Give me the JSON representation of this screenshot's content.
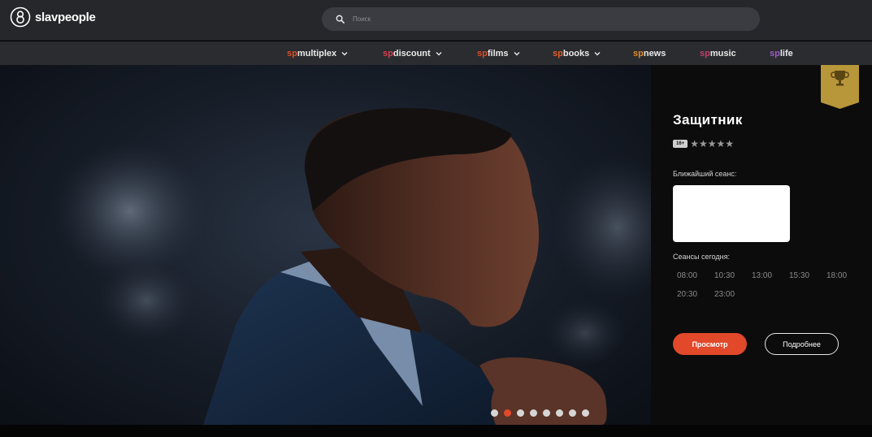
{
  "brand": {
    "logo_text": "slavpeople",
    "accent": "#e2482a"
  },
  "search": {
    "placeholder": "Поиск",
    "icon": "search-icon"
  },
  "nav": [
    {
      "prefix": "sp",
      "label": "multiplex",
      "dropdown": true
    },
    {
      "prefix": "sp",
      "label": "discount",
      "dropdown": true
    },
    {
      "prefix": "sp",
      "label": "films",
      "dropdown": true
    },
    {
      "prefix": "sp",
      "label": "books",
      "dropdown": true
    },
    {
      "prefix": "sp",
      "label": "news",
      "dropdown": false
    },
    {
      "prefix": "sp",
      "label": "music",
      "dropdown": false
    },
    {
      "prefix": "sp",
      "label": "life",
      "dropdown": false
    }
  ],
  "nav_prefix_colors": [
    "#d9502c",
    "#d94050",
    "#d94e2c",
    "#e0602a",
    "#e08a2a",
    "#c0406a",
    "#9a5cc0"
  ],
  "film": {
    "title": "Защитник",
    "age_rating": "16+",
    "stars": "★★★★★",
    "nearest_label": "Ближайший сеанс:",
    "today_label": "Сеансы сегодня:",
    "times": [
      "08:00",
      "10:30",
      "13:00",
      "15:30",
      "18:00",
      "20:30",
      "23:00"
    ],
    "watch_label": "Просмотр",
    "more_label": "Подробнее"
  },
  "slider": {
    "count": 8,
    "active_index": 1
  }
}
